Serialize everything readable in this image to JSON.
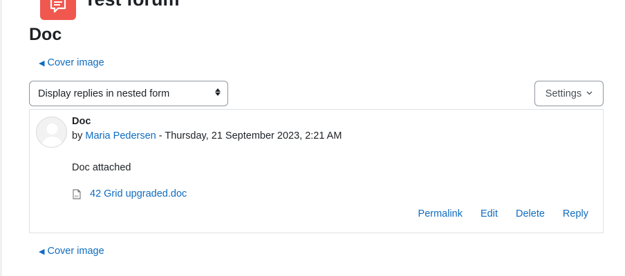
{
  "forum": {
    "title": "Test forum",
    "icon": "forum-icon",
    "icon_color": "#f0584f"
  },
  "page": {
    "title": "Doc"
  },
  "nav": {
    "prev_label": "Cover image",
    "next_label": "Cover image",
    "arrow": "◀"
  },
  "display_mode": {
    "selected": "Display replies in nested form"
  },
  "settings": {
    "label": "Settings",
    "chevron": "⌄"
  },
  "post": {
    "subject": "Doc",
    "by_prefix": "by",
    "author": "Maria Pedersen",
    "date_sep": " - ",
    "date": "Thursday, 21 September 2023, 2:21 AM",
    "message": "Doc attached",
    "attachment": {
      "filename": "42 Grid upgraded.doc",
      "icon": "doc-file-icon"
    },
    "actions": {
      "permalink": "Permalink",
      "edit": "Edit",
      "delete": "Delete",
      "reply": "Reply"
    }
  },
  "colors": {
    "link": "#0f6cbf",
    "text": "#1d2125",
    "border": "#dee2e6"
  }
}
